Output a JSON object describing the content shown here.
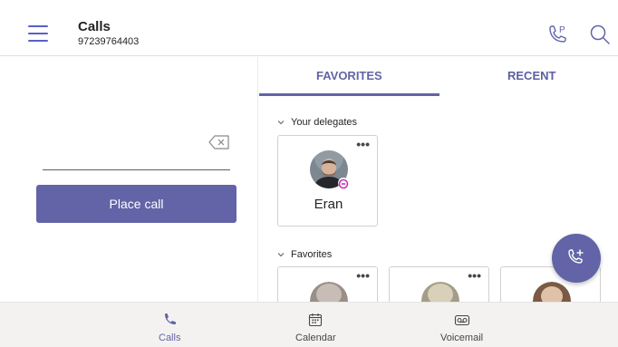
{
  "header": {
    "title": "Calls",
    "number": "97239764403",
    "icons": [
      "hamburger-menu-icon",
      "call-park-icon",
      "search-icon"
    ]
  },
  "dialpad": {
    "input_value": "",
    "place_call_label": "Place call"
  },
  "tabs": [
    {
      "label": "FAVORITES",
      "active": true
    },
    {
      "label": "RECENT",
      "active": false
    }
  ],
  "delegates": {
    "heading": "Your delegates",
    "contacts": [
      {
        "name": "Eran",
        "more": "•••"
      }
    ]
  },
  "favorites": {
    "heading": "Favorites",
    "more": "•••"
  },
  "bottom_nav": [
    {
      "label": "Calls",
      "icon": "phone-icon",
      "active": true
    },
    {
      "label": "Calendar",
      "icon": "calendar-icon",
      "active": false
    },
    {
      "label": "Voicemail",
      "icon": "voicemail-icon",
      "active": false
    }
  ],
  "colors": {
    "accent": "#6264a7",
    "nav_background": "#f3f2f1"
  }
}
